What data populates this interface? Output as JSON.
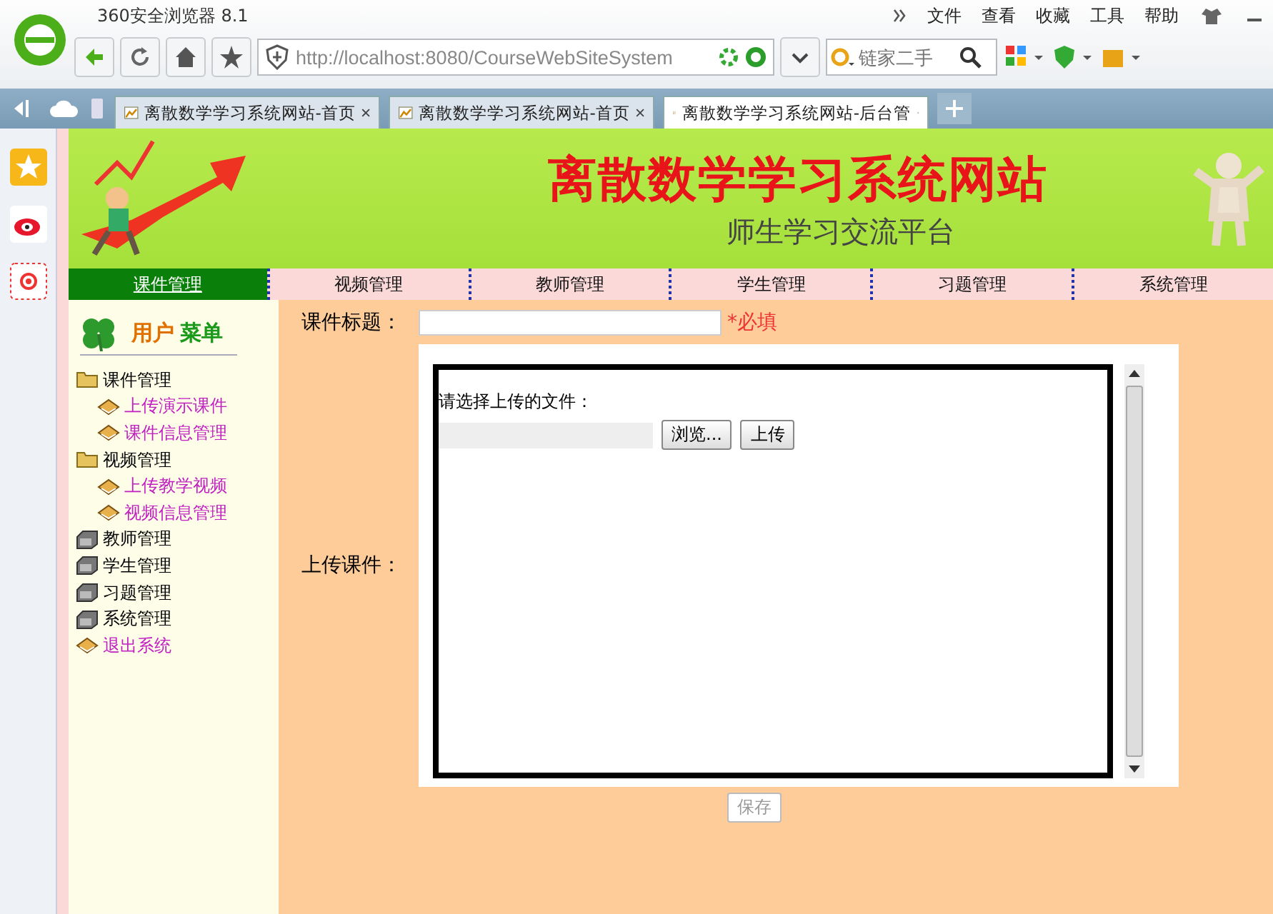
{
  "browser": {
    "title": "360安全浏览器 8.1",
    "menu": [
      "文件",
      "查看",
      "收藏",
      "工具",
      "帮助"
    ],
    "address": "http://localhost:8080/CourseWebSiteSystem",
    "search": {
      "placeholder": "链家二手"
    },
    "tabs": [
      {
        "label": "离散数学学习系统网站-首页",
        "selected": false
      },
      {
        "label": "离散数学学习系统网站-首页",
        "selected": false
      },
      {
        "label": "离散数学学习系统网站-后台管",
        "selected": true
      }
    ]
  },
  "banner": {
    "title": "离散数学学习系统网站",
    "subtitle": "师生学习交流平台"
  },
  "nav": [
    {
      "label": "课件管理",
      "selected": true
    },
    {
      "label": "视频管理",
      "selected": false
    },
    {
      "label": "教师管理",
      "selected": false
    },
    {
      "label": "学生管理",
      "selected": false
    },
    {
      "label": "习题管理",
      "selected": false
    },
    {
      "label": "系统管理",
      "selected": false
    }
  ],
  "sidebar": {
    "title_parts": [
      "用户",
      "菜单"
    ],
    "items": [
      {
        "label": "课件管理",
        "kind": "folder",
        "children": [
          {
            "label": "上传演示课件",
            "kind": "link"
          },
          {
            "label": "课件信息管理",
            "kind": "link"
          }
        ]
      },
      {
        "label": "视频管理",
        "kind": "folder",
        "children": [
          {
            "label": "上传教学视频",
            "kind": "link"
          },
          {
            "label": "视频信息管理",
            "kind": "link"
          }
        ]
      },
      {
        "label": "教师管理",
        "kind": "drawer"
      },
      {
        "label": "学生管理",
        "kind": "drawer"
      },
      {
        "label": "习题管理",
        "kind": "drawer"
      },
      {
        "label": "系统管理",
        "kind": "drawer"
      },
      {
        "label": "退出系统",
        "kind": "link"
      }
    ]
  },
  "form": {
    "title_label": "课件标题：",
    "required": "*必填",
    "upload_label": "上传课件：",
    "prompt": "请选择上传的文件：",
    "browse": "浏览...",
    "upload": "上传",
    "save": {
      "label": "保存",
      "disabled": true
    }
  }
}
